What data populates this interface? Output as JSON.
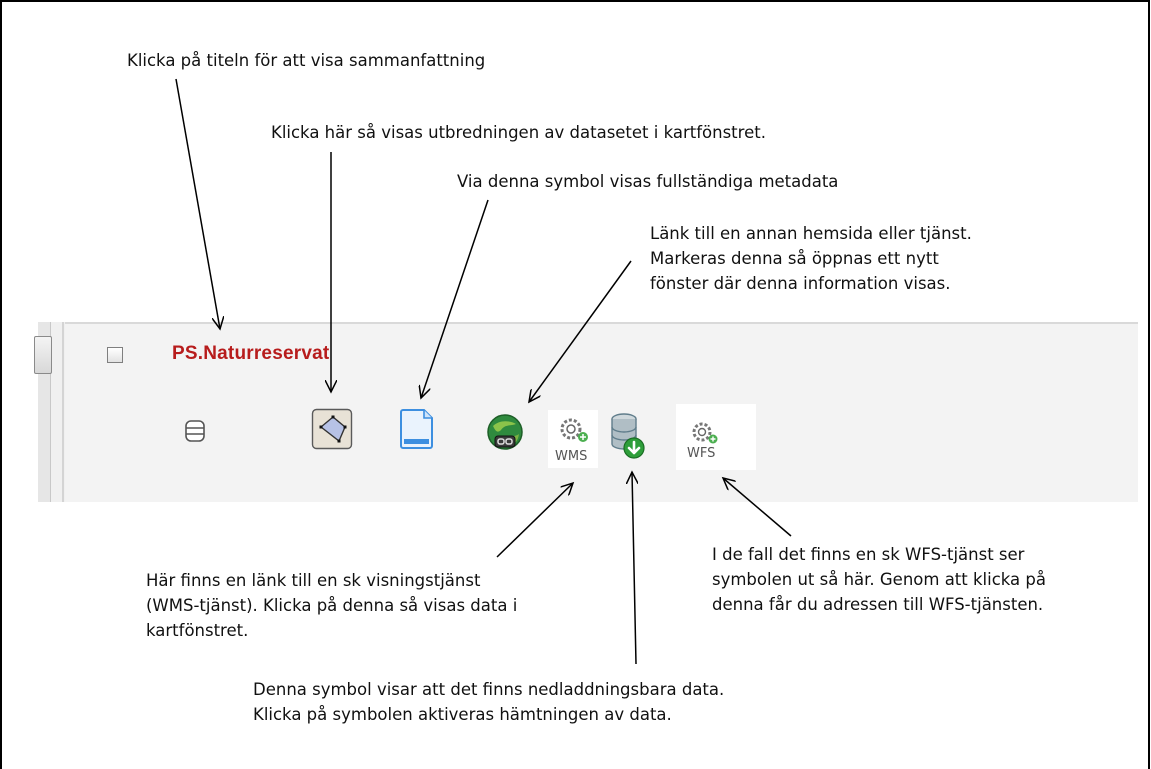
{
  "layer": {
    "title": "PS.Naturreservat"
  },
  "annotations": {
    "title_summary": "Klicka på titeln för att visa sammanfattning",
    "extent": "Klicka här så visas utbredningen av datasetet i kartfönstret.",
    "metadata": "Via denna symbol visas fullständiga metadata",
    "link": "Länk till en annan hemsida eller tjänst.\nMarkeras denna så öppnas ett nytt\nfönster där denna information visas.",
    "wms": "Här finns en länk till en sk visningstjänst\n(WMS-tjänst). Klicka på denna så visas data i\nkartfönstret.",
    "download": "Denna symbol visar att det finns nedladdningsbara data.\nKlicka på symbolen aktiveras hämtningen av data.",
    "wfs": "I de fall det finns en sk WFS-tjänst ser\nsymbolen ut så här. Genom att klicka på\ndenna får du adressen till WFS-tjänsten."
  },
  "icons": {
    "dataset": "database-icon",
    "extent": "polygon-extent-icon",
    "metadata": "document-icon",
    "link": "globe-link-icon",
    "wms": "wms-service-icon",
    "download": "download-database-icon",
    "wfs": "wfs-service-icon",
    "wms_label": "WMS",
    "wfs_label": "WFS"
  },
  "colors": {
    "title": "#b71c1c",
    "download_green": "#2e9e3a",
    "document_blue": "#3d8fe0"
  }
}
